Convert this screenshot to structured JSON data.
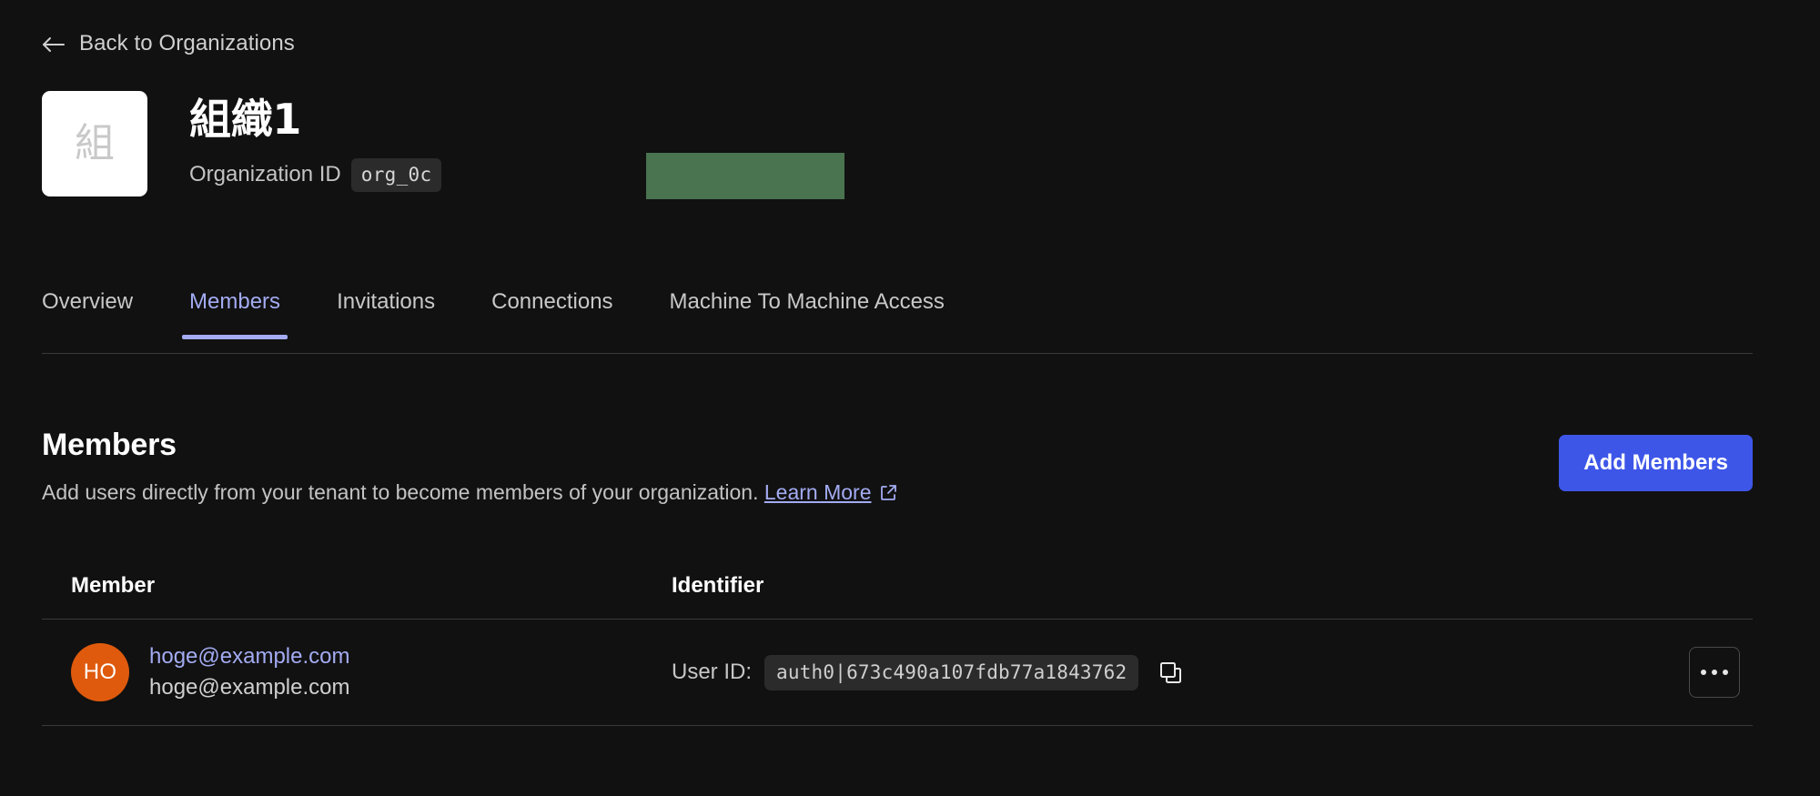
{
  "nav": {
    "back_label": "Back to Organizations",
    "back_icon": "arrow-left-icon"
  },
  "org": {
    "logo_char": "組",
    "title": "組織1",
    "id_label": "Organization ID",
    "id_value": "org_0c",
    "redacted": true,
    "redaction_color": "#4a7350"
  },
  "tabs": [
    {
      "label": "Overview",
      "active": false
    },
    {
      "label": "Members",
      "active": true
    },
    {
      "label": "Invitations",
      "active": false
    },
    {
      "label": "Connections",
      "active": false
    },
    {
      "label": "Machine To Machine Access",
      "active": false
    }
  ],
  "members_section": {
    "heading": "Members",
    "description": "Add users directly from your tenant to become members of your organization.",
    "learn_more_label": "Learn More",
    "learn_more_icon": "external-link-icon",
    "add_button_label": "Add Members",
    "accent_color": "#3e56e8",
    "link_color": "#a3abf2"
  },
  "table": {
    "columns": [
      "Member",
      "Identifier"
    ],
    "rows": [
      {
        "avatar_initials": "HO",
        "avatar_color": "#df5a0d",
        "member_name": "hoge@example.com",
        "member_email": "hoge@example.com",
        "identifier_label": "User ID:",
        "identifier_value": "auth0|673c490a107fdb77a1843762",
        "copy_icon": "copy-icon",
        "actions_icon": "more-options-icon"
      }
    ]
  }
}
